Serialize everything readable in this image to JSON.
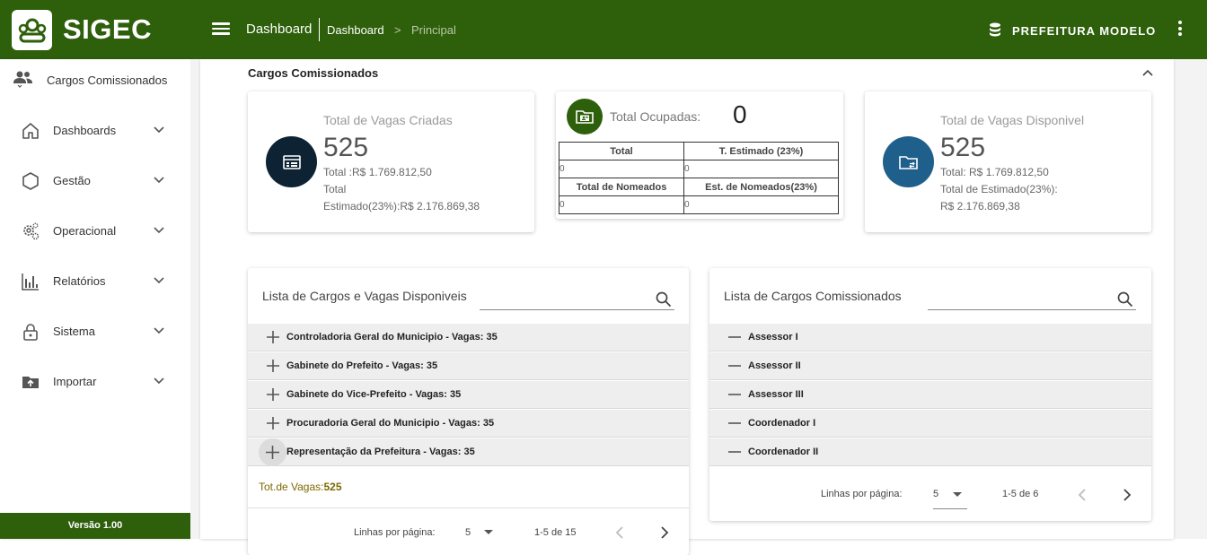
{
  "header": {
    "brand": "SIGEC",
    "title": "Dashboard",
    "breadcrumb": [
      "Dashboard",
      "Principal"
    ],
    "breadcrumb_sep": ">",
    "org_name": "PREFEITURA MODELO",
    "colors": {
      "primary": "#2e5f0b"
    }
  },
  "sidebar": {
    "heading": "Cargos Comissionados",
    "items": [
      {
        "label": "Dashboards",
        "icon": "home-icon"
      },
      {
        "label": "Gestão",
        "icon": "hexagon-icon"
      },
      {
        "label": "Operacional",
        "icon": "gears-icon"
      },
      {
        "label": "Relatórios",
        "icon": "bar-chart-icon"
      },
      {
        "label": "Sistema",
        "icon": "lock-icon"
      },
      {
        "label": "Importar",
        "icon": "folder-upload-icon"
      }
    ],
    "version": "Versão 1.00"
  },
  "section": {
    "title": "Cargos Comissionados"
  },
  "kpi_criadas": {
    "title": "Total de Vagas Criadas",
    "value": "525",
    "line1": "Total :R$ 1.769.812,50",
    "line2": "Total",
    "line3": "Estimado(23%):R$ 2.176.869,38"
  },
  "kpi_ocupadas": {
    "title": "Total Ocupadas:",
    "value": "0",
    "table": {
      "h1": "Total",
      "h2": "T. Estimado (23%)",
      "r1c1": "0",
      "r1c2": "0",
      "h3": "Total de Nomeados",
      "h4": "Est. de Nomeados(23%)",
      "r2c1": "0",
      "r2c2": "0"
    }
  },
  "kpi_disponivel": {
    "title": "Total de Vagas Disponivel",
    "value": "525",
    "line1": "Total: R$ 1.769.812,50",
    "line2": "Total de Estimado(23%):",
    "line3": "R$ 2.176.869,38"
  },
  "list_vagas": {
    "title": "Lista de Cargos e Vagas Disponiveis",
    "rows": [
      "Controladoria Geral do Municipio - Vagas: 35",
      "Gabinete do Prefeito - Vagas: 35",
      "Gabinete do Vice-Prefeito - Vagas: 35",
      "Procuradoria Geral do Municipio - Vagas: 35",
      "Representação da Prefeitura - Vagas: 35"
    ],
    "total_label": "Tot.de Vagas:",
    "total_value": "525",
    "rows_per_page_label": "Linhas por página:",
    "rows_per_page": "5",
    "range": "1-5 de 15"
  },
  "list_cargos": {
    "title": "Lista de Cargos Comissionados",
    "rows": [
      "Assessor I",
      "Assessor II",
      "Assessor III",
      "Coordenador I",
      "Coordenador II"
    ],
    "rows_per_page_label": "Linhas por página:",
    "rows_per_page": "5",
    "range": "1-5 de 6"
  }
}
